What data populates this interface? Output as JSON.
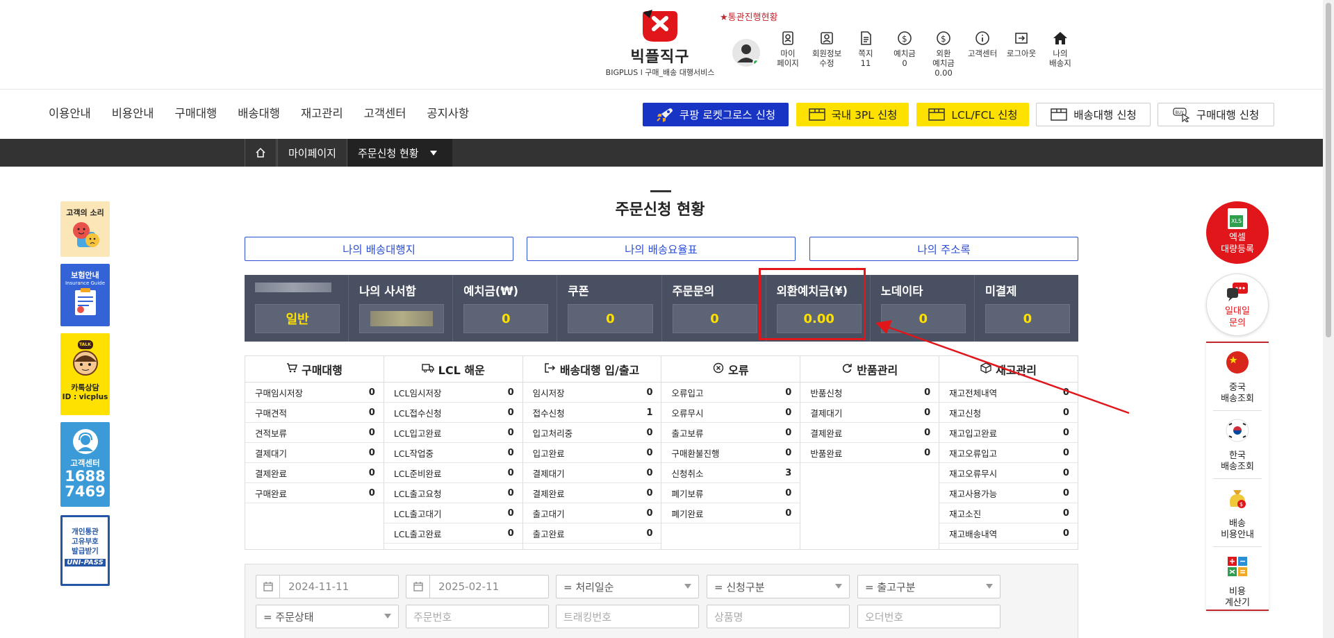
{
  "header": {
    "logo_name": "빅플직구",
    "logo_sub": "BIGPLUS l 구매_배송 대행서비스",
    "notice": "★통관진행현황",
    "icons": [
      {
        "name": "mypage-icon",
        "label": "마이\n페이지"
      },
      {
        "name": "member-edit-icon",
        "label": "회원정보\n수정"
      },
      {
        "name": "message-icon",
        "label": "쪽지\n11"
      },
      {
        "name": "deposit-icon",
        "label": "예치금\n0"
      },
      {
        "name": "fx-deposit-icon",
        "label": "외환\n예치금\n0.00"
      },
      {
        "name": "info-icon",
        "label": "고객센터"
      },
      {
        "name": "logout-icon",
        "label": "로그아웃"
      },
      {
        "name": "home-icon",
        "label": "나의\n배송지"
      }
    ]
  },
  "nav": [
    "이용안내",
    "비용안내",
    "구매대행",
    "배송대행",
    "재고관리",
    "고객센터",
    "공지사항"
  ],
  "service_buttons": [
    "쿠팡 로켓그로스 신청",
    "국내 3PL 신청",
    "LCL/FCL 신청",
    "배송대행 신청",
    "구매대행 신청"
  ],
  "breadcrumb": {
    "mypage": "마이페이지",
    "current": "주문신청 현황"
  },
  "left_banners": {
    "voice": "고객의 소리",
    "insurance": "보험안내",
    "insurance_sub": "Insurance Guide",
    "kakao_talk": "TALK",
    "kakao": "카톡상담",
    "kakao_id": "ID : vicplus",
    "cs": "고객센터",
    "cs_num1": "1688",
    "cs_num2": "7469",
    "customs": "개인통관\n고유부호\n발급받기",
    "customs_logo": "UNI-PASS"
  },
  "page_title": "주문신청 현황",
  "link_buttons": [
    "나의 배송대행지",
    "나의 배송요율표",
    "나의 주소록"
  ],
  "stats": [
    {
      "label": "",
      "value": "일반"
    },
    {
      "label": "나의 사서함",
      "value": ""
    },
    {
      "label": "예치금(₩)",
      "value": "0"
    },
    {
      "label": "쿠폰",
      "value": "0"
    },
    {
      "label": "주문문의",
      "value": "0"
    },
    {
      "label": "외환예치금(¥)",
      "value": "0.00"
    },
    {
      "label": "노데이타",
      "value": "0"
    },
    {
      "label": "미결제",
      "value": "0"
    }
  ],
  "categories": [
    {
      "title": "구매대행",
      "icon": "cart-icon",
      "rows": [
        [
          "구매임시저장",
          "0"
        ],
        [
          "구매견적",
          "0"
        ],
        [
          "견적보류",
          "0"
        ],
        [
          "결제대기",
          "0"
        ],
        [
          "결제완료",
          "0"
        ],
        [
          "구매완료",
          "0"
        ]
      ]
    },
    {
      "title": "LCL 해운",
      "icon": "truck-icon",
      "rows": [
        [
          "LCL임시저장",
          "0"
        ],
        [
          "LCL접수신청",
          "0"
        ],
        [
          "LCL입고완료",
          "0"
        ],
        [
          "LCL작업중",
          "0"
        ],
        [
          "LCL준비완료",
          "0"
        ],
        [
          "LCL출고요청",
          "0"
        ],
        [
          "LCL출고대기",
          "0"
        ],
        [
          "LCL출고완료",
          "0"
        ]
      ]
    },
    {
      "title": "배송대행 입/출고",
      "icon": "inout-icon",
      "rows": [
        [
          "임시저장",
          "0"
        ],
        [
          "접수신청",
          "1"
        ],
        [
          "입고처리중",
          "0"
        ],
        [
          "입고완료",
          "0"
        ],
        [
          "결제대기",
          "0"
        ],
        [
          "결제완료",
          "0"
        ],
        [
          "출고대기",
          "0"
        ],
        [
          "출고완료",
          "0"
        ]
      ]
    },
    {
      "title": "오류",
      "icon": "error-icon",
      "rows": [
        [
          "오류입고",
          "0"
        ],
        [
          "오류무시",
          "0"
        ],
        [
          "출고보류",
          "0"
        ],
        [
          "구매환불진행",
          "0"
        ],
        [
          "신청취소",
          "3"
        ],
        [
          "폐기보류",
          "0"
        ],
        [
          "폐기완료",
          "0"
        ]
      ]
    },
    {
      "title": "반품관리",
      "icon": "return-icon",
      "rows": [
        [
          "반품신청",
          "0"
        ],
        [
          "결제대기",
          "0"
        ],
        [
          "결제완료",
          "0"
        ],
        [
          "반품완료",
          "0"
        ]
      ]
    },
    {
      "title": "재고관리",
      "icon": "box-icon",
      "rows": [
        [
          "재고전체내역",
          "0"
        ],
        [
          "재고신청",
          "0"
        ],
        [
          "재고입고완료",
          "0"
        ],
        [
          "재고오류입고",
          "0"
        ],
        [
          "재고오류무시",
          "0"
        ],
        [
          "재고사용가능",
          "0"
        ],
        [
          "재고소진",
          "0"
        ],
        [
          "재고배송내역",
          "0"
        ]
      ]
    }
  ],
  "filter": {
    "date_from": "2024-11-11",
    "date_to": "2025-02-11",
    "sort": "= 처리일순",
    "apply_type": "= 신청구분",
    "ship_type": "= 출고구분",
    "order_status": "= 주문상태",
    "order_no": "주문번호",
    "tracking_no": "트래킹번호",
    "product_name": "상품명",
    "order_ref": "오더번호"
  },
  "right_side": {
    "excel_tag": "XLS",
    "excel": "엑셀\n대량등록",
    "inquiry": "일대일\n문의",
    "items": [
      {
        "name": "china-tracking",
        "label": "중국\n배송조회"
      },
      {
        "name": "korea-tracking",
        "label": "한국\n배송조회"
      },
      {
        "name": "shipping-cost-guide",
        "label": "배송\n비용안내"
      },
      {
        "name": "cost-calculator",
        "label": "비용\n계산기"
      }
    ]
  },
  "colors": {
    "accent_blue": "#1734c5",
    "accent_yellow": "#ffe100",
    "brand_red": "#e0161b",
    "stats_bg": "#495062"
  }
}
